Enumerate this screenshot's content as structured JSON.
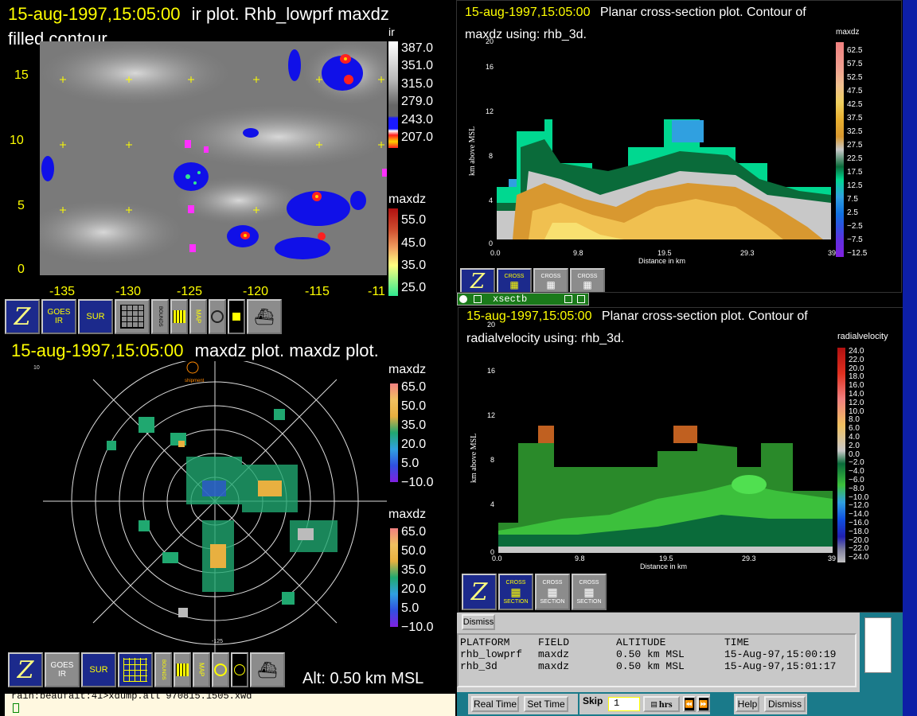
{
  "colors": {
    "title_time": "#ffff00",
    "ir_window_bg": "#000000",
    "cross_bg": "#000000",
    "desktop": "#0d1fa6",
    "panel_gray": "#c8c8c8"
  },
  "ir_window": {
    "time": "15-aug-1997,15:05:00",
    "title_rest": "ir plot.  Rhb_lowprf maxdz",
    "title_line2": "filled contour.",
    "y_ticks": [
      "15",
      "10",
      "5",
      "0"
    ],
    "x_ticks": [
      "-135",
      "-130",
      "-125",
      "-120",
      "-115",
      "-11"
    ],
    "ir_legend_title": "ir",
    "ir_legend": [
      "387.0",
      "351.0",
      "315.0",
      "279.0",
      "243.0",
      "207.0"
    ],
    "dz_legend_title": "maxdz",
    "dz_legend": [
      "55.0",
      "45.0",
      "35.0",
      "25.0"
    ],
    "toolbar": [
      "Z",
      "GOES IR",
      "SUR",
      "grid",
      "BOUNDS",
      "grid2",
      "MAP",
      "ring",
      "marker",
      "ship"
    ]
  },
  "maxdz_window": {
    "time": "15-aug-1997,15:05:00",
    "title_rest": "maxdz plot.  maxdz plot.",
    "legend1_title": "maxdz",
    "legend1": [
      "65.0",
      "50.0",
      "35.0",
      "20.0",
      "5.0",
      "−10.0"
    ],
    "legend2_title": "maxdz",
    "legend2": [
      "65.0",
      "50.0",
      "35.0",
      "20.0",
      "5.0",
      "−10.0"
    ],
    "tiny_label_left": "10",
    "tiny_label_bottom": "-125",
    "ship_label": "shipment",
    "altitude": "Alt: 0.50 km MSL",
    "toolbar": [
      "Z",
      "GOES IR",
      "SUR",
      "grid",
      "BOUNDS",
      "grid2",
      "MAP",
      "ring",
      "circle",
      "ship"
    ]
  },
  "cross1": {
    "time": "15-aug-1997,15:05:00",
    "title_rest": "Planar cross-section plot.  Contour of",
    "title_line2": "maxdz using: rhb_3d.",
    "ylabel": "km above MSL",
    "xlabel": "Distance in km",
    "y_ticks": [
      "16",
      "12",
      "8",
      "4",
      "0"
    ],
    "x_ticks": [
      "0.0",
      "9.8",
      "19.5",
      "29.3",
      "39"
    ],
    "legend_title": "maxdz",
    "legend": [
      "62.5",
      "57.5",
      "52.5",
      "47.5",
      "42.5",
      "37.5",
      "32.5",
      "27.5",
      "22.5",
      "17.5",
      "12.5",
      "7.5",
      "2.5",
      "−2.5",
      "−7.5",
      "−12.5"
    ],
    "toolbar_labels": [
      "CROSS",
      "CROSS",
      "CROSS"
    ],
    "toolbar_sub": [
      "SECTION",
      "SECTION",
      "SECTION"
    ]
  },
  "xsect_bar": {
    "title": "xsectb"
  },
  "cross2": {
    "top_tick": "20",
    "time": "15-aug-1997,15:05:00",
    "title_rest": "Planar cross-section plot.  Contour of",
    "title_line2": "radialvelocity using: rhb_3d.",
    "ylabel": "km above MSL",
    "xlabel": "Distance in km",
    "y_ticks": [
      "16",
      "12",
      "8",
      "4",
      "0"
    ],
    "x_ticks": [
      "0.0",
      "9.8",
      "19.5",
      "29.3",
      "39"
    ],
    "legend_title": "radialvelocity",
    "legend": [
      "24.0",
      "22.0",
      "20.0",
      "18.0",
      "16.0",
      "14.0",
      "12.0",
      "10.0",
      "8.0",
      "6.0",
      "4.0",
      "2.0",
      "0.0",
      "−2.0",
      "−4.0",
      "−6.0",
      "−8.0",
      "−10.0",
      "−12.0",
      "−14.0",
      "−16.0",
      "−18.0",
      "−20.0",
      "−22.0",
      "−24.0"
    ],
    "toolbar_labels": [
      "CROSS",
      "CROSS",
      "CROSS"
    ],
    "toolbar_sub": [
      "SECTION",
      "SECTION",
      "SECTION"
    ]
  },
  "cross1_top_tick": "20",
  "info": {
    "dismiss": "Dismiss",
    "headers": [
      "PLATFORM",
      "FIELD",
      "ALTITUDE",
      "TIME"
    ],
    "rows": [
      [
        "rhb_lowprf",
        "maxdz",
        "0.50 km MSL",
        "15-Aug-97,15:00:19"
      ],
      [
        "rhb_3d",
        "maxdz",
        "0.50 km MSL",
        "15-Aug-97,15:01:17"
      ]
    ]
  },
  "terminal": {
    "line": "rain:beaufait:41>xdump.all 970815.1505.xwd"
  },
  "controls": {
    "real_time": "Real Time",
    "set_time": "Set Time",
    "skip": "Skip",
    "skip_value": "1",
    "unit": "hrs",
    "help": "Help",
    "dismiss": "Dismiss"
  }
}
